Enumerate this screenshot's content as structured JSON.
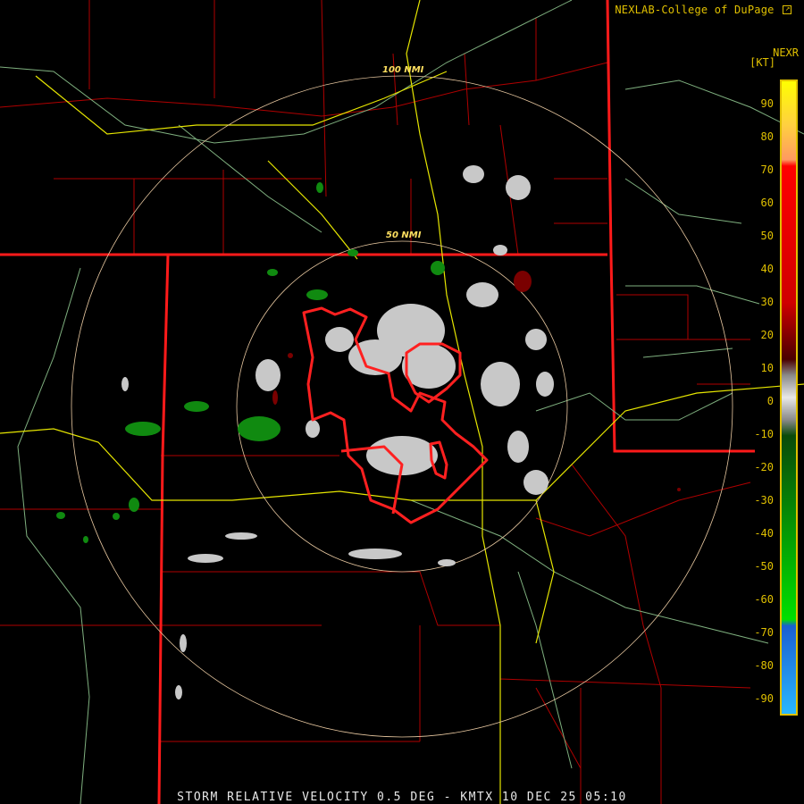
{
  "header": {
    "credit": "NEXLAB-College of DuPage",
    "credit_icon": "external-link-icon",
    "product_code": "NEXR",
    "unit": "[KT]"
  },
  "rings": {
    "inner_label": "50 NMI",
    "outer_label": "100 NMI"
  },
  "legend": {
    "ticks": [
      "90",
      "80",
      "70",
      "60",
      "50",
      "40",
      "30",
      "20",
      "10",
      "0",
      "-10",
      "-20",
      "-30",
      "-40",
      "-50",
      "-60",
      "-70",
      "-80",
      "-90"
    ],
    "colors": {
      "high": "#ff0000",
      "mid_high": "#ff9a60",
      "top": "#ffe600",
      "dark_red": "#5a0000",
      "neutral": "#d0d0d0",
      "dark_green": "#0a5a0a",
      "bright_green": "#00e000",
      "blue": "#1a5fd0",
      "light_blue": "#2ab8ff"
    }
  },
  "map_colors": {
    "county_lines": "#c00000",
    "state_lines": "#ff2020",
    "highways": "#e6e600",
    "rivers": "#80c080",
    "warnings": "#ff2020",
    "rings": "#e8c8a0"
  },
  "footer": {
    "caption": "STORM RELATIVE VELOCITY 0.5 DEG - KMTX 10 DEC 25 05:10"
  }
}
